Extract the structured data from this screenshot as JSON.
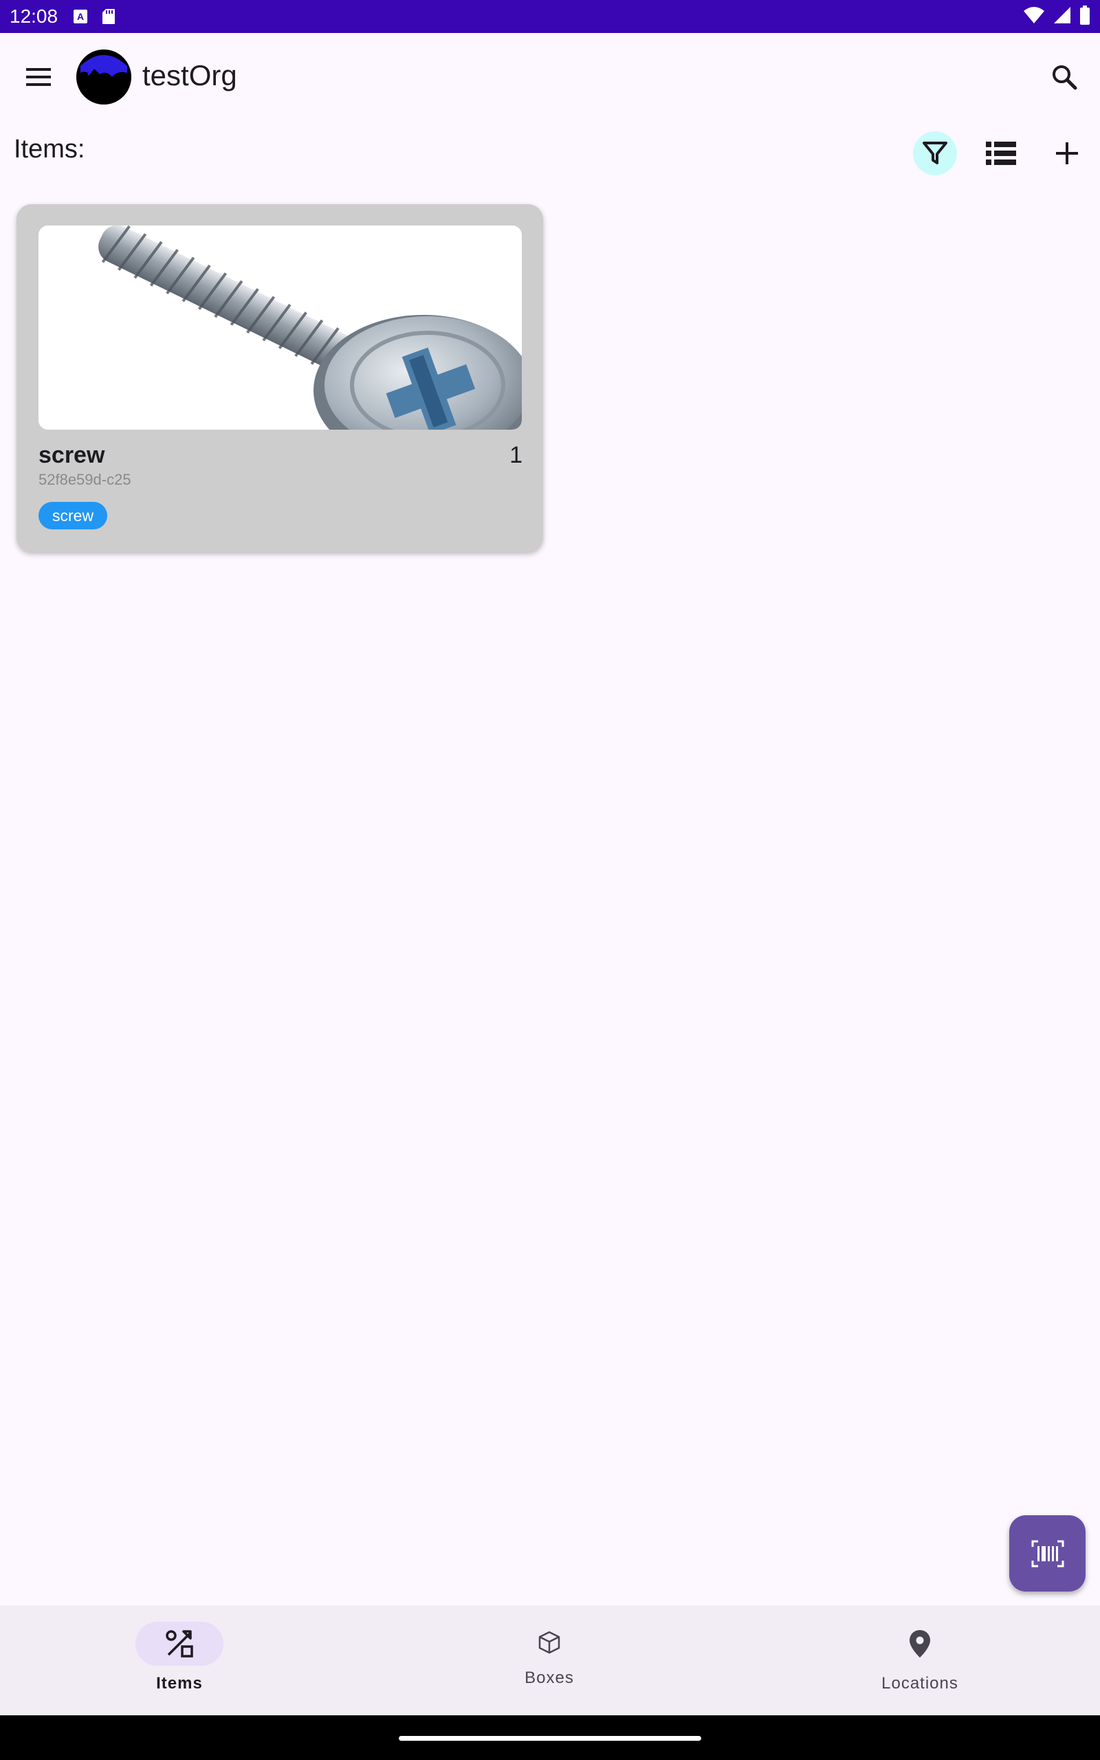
{
  "status_bar": {
    "time": "12:08",
    "icons": [
      "keyboard-a-icon",
      "sd-card-icon",
      "wifi-icon",
      "cellular-signal-icon",
      "battery-icon"
    ]
  },
  "app_bar": {
    "org_name": "testOrg",
    "menu_icon": "hamburger-menu-icon",
    "search_icon": "search-icon"
  },
  "items_section": {
    "heading": "Items:",
    "actions": [
      "filter-icon",
      "list-view-icon",
      "add-icon"
    ],
    "filter_active_color": "#C9FBFB"
  },
  "items": [
    {
      "name": "screw",
      "count": "1",
      "id": "52f8e59d-c25",
      "tag": "screw",
      "tag_color": "#2196F3",
      "image": "screw-photo"
    }
  ],
  "fab": {
    "icon": "barcode-scan-icon",
    "color": "#6750A4"
  },
  "bottom_nav": {
    "items": [
      {
        "label": "Items",
        "icon": "items-shapes-icon",
        "active": true
      },
      {
        "label": "Boxes",
        "icon": "box-icon",
        "active": false
      },
      {
        "label": "Locations",
        "icon": "location-pin-icon",
        "active": false
      }
    ]
  },
  "colors": {
    "status_bar": "#3A05B3",
    "background": "#FDF7FF",
    "nav_background": "#F2ECF4",
    "nav_active_pill": "#E8DEF8"
  }
}
